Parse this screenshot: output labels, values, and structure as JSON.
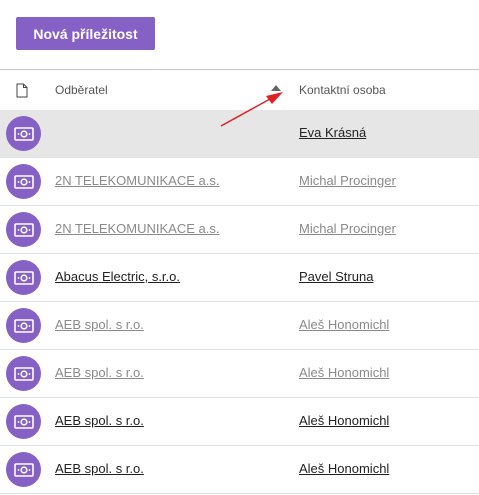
{
  "toolbar": {
    "new_button_label": "Nová příležitost"
  },
  "table": {
    "columns": [
      "Odběratel",
      "Kontaktní osoba"
    ],
    "sort": {
      "column": "Kontaktní osoba",
      "direction": "ascending"
    },
    "rows": [
      {
        "customer": "",
        "contact": "Eva Krásná",
        "selected": true,
        "muted": false
      },
      {
        "customer": "2N TELEKOMUNIKACE a.s.",
        "contact": "Michal Procinger",
        "selected": false,
        "muted": true
      },
      {
        "customer": "2N TELEKOMUNIKACE a.s.",
        "contact": "Michal Procinger",
        "selected": false,
        "muted": true
      },
      {
        "customer": "Abacus Electric, s.r.o.",
        "contact": "Pavel Struna",
        "selected": false,
        "muted": false
      },
      {
        "customer": "AEB spol. s r.o.",
        "contact": "Aleš Honomichl",
        "selected": false,
        "muted": true
      },
      {
        "customer": "AEB spol. s r.o.",
        "contact": "Aleš Honomichl",
        "selected": false,
        "muted": true
      },
      {
        "customer": "AEB spol. s r.o.",
        "contact": "Aleš Honomichl",
        "selected": false,
        "muted": false
      },
      {
        "customer": "AEB spol. s r.o.",
        "contact": "Aleš Honomichl",
        "selected": false,
        "muted": false
      }
    ]
  },
  "icons": {
    "row_icon": "opportunity-money-icon",
    "header_icon": "document-icon"
  },
  "colors": {
    "accent": "#8561c5",
    "annotation": "#e02020"
  }
}
